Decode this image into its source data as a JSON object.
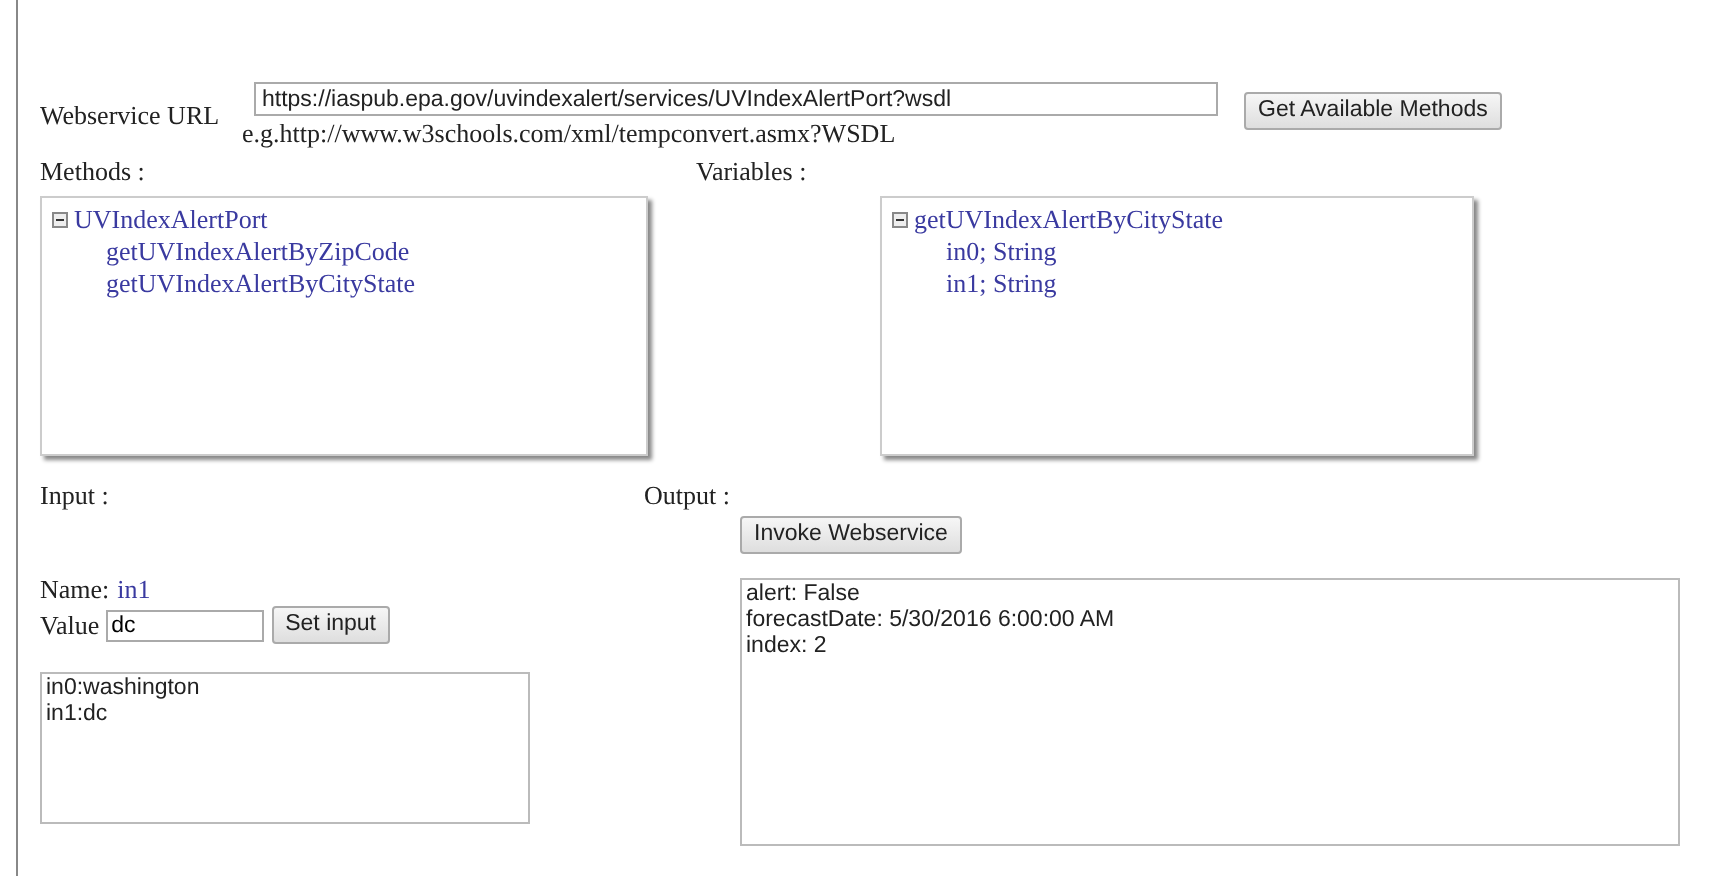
{
  "url_field": {
    "label": "Webservice URL",
    "value": "https://iaspub.epa.gov/uvindexalert/services/UVIndexAlertPort?wsdl",
    "hint": "e.g.http://www.w3schools.com/xml/tempconvert.asmx?WSDL",
    "button": "Get Available Methods"
  },
  "methods": {
    "label": "Methods :",
    "tree": [
      {
        "label": "UVIndexAlertPort",
        "expanded": true,
        "children": [
          {
            "label": "getUVIndexAlertByZipCode"
          },
          {
            "label": "getUVIndexAlertByCityState"
          }
        ]
      }
    ]
  },
  "variables": {
    "label": "Variables :",
    "tree": [
      {
        "label": "getUVIndexAlertByCityState",
        "expanded": true,
        "children": [
          {
            "label": "in0; String"
          },
          {
            "label": "in1; String"
          }
        ]
      }
    ]
  },
  "input": {
    "label": "Input :",
    "name_label": "Name:",
    "name_value": "in1",
    "value_label": "Value",
    "value": "dc",
    "button": "Set input",
    "list": [
      "in0:washington",
      "in1:dc"
    ]
  },
  "output": {
    "label": "Output :",
    "button": "Invoke Webservice",
    "result": [
      "alert: False",
      "forecastDate: 5/30/2016 6:00:00 AM",
      "index: 2"
    ]
  }
}
